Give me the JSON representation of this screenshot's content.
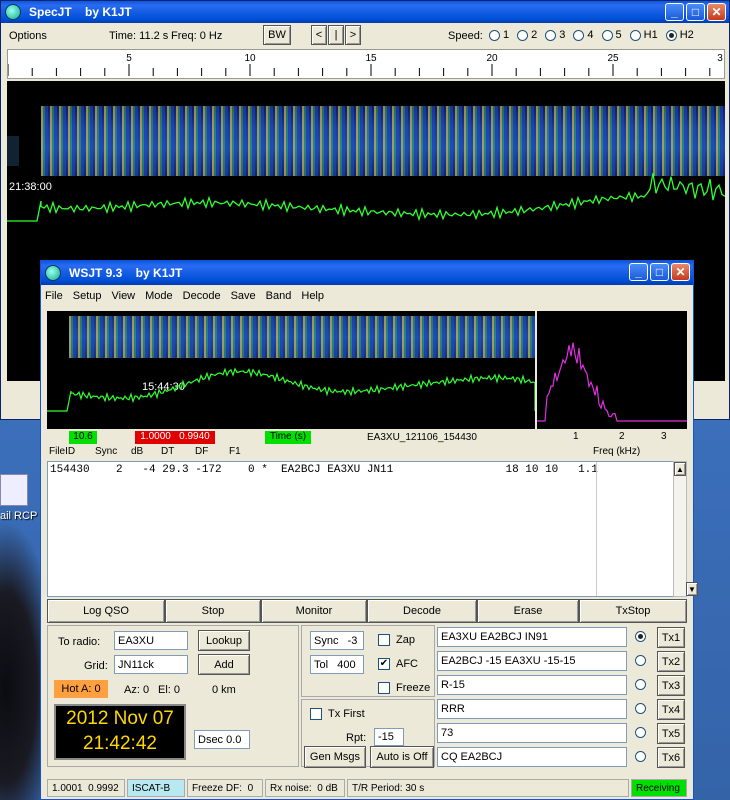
{
  "desktop": {
    "icon_label": "ail RCP"
  },
  "spec": {
    "title": "SpecJT    by K1JT",
    "options": "Options",
    "time": "Time: 11.2 s",
    "freq": "Freq: 0 Hz",
    "bw": "BW",
    "nav": [
      "<",
      "|",
      ">"
    ],
    "speed_label": "Speed:",
    "speeds": [
      "1",
      "2",
      "3",
      "4",
      "5",
      "H1",
      "H2"
    ],
    "speed_selected": "H2",
    "scale_labels": [
      "5",
      "10",
      "15",
      "20",
      "25",
      "3"
    ],
    "timestamp": "21:38:00"
  },
  "wsjt": {
    "title": "WSJT 9.3    by K1JT",
    "menu": [
      "File",
      "Setup",
      "View",
      "Mode",
      "Decode",
      "Save",
      "Band",
      "Help"
    ],
    "plot_label": "15:44:30",
    "freq_ticks": [
      "1",
      "2",
      "3"
    ],
    "status_green1": "10.6",
    "status_red": "1.0000   0.9940",
    "status_green2": "Time (s)",
    "file_id": "EA3XU_121106_154430",
    "freq_label": "Freq (kHz)",
    "col_headers": [
      "FileID",
      "Sync",
      "dB",
      "DT",
      "DF",
      "F1"
    ],
    "decode_line": "154430    2   -4 29.3 -172    0 *  EA2BCJ EA3XU JN11                 18 10 10   1.1",
    "buttons": {
      "log": "Log QSO",
      "stop": "Stop",
      "monitor": "Monitor",
      "decode": "Decode",
      "erase": "Erase",
      "txstop": "TxStop"
    },
    "to_radio_label": "To radio:",
    "to_radio": "EA3XU",
    "grid_label": "Grid:",
    "grid": "JN11ck",
    "lookup": "Lookup",
    "add": "Add",
    "hot": "Hot A: 0",
    "az": "Az: 0",
    "el": "El: 0",
    "km": "0 km",
    "date": "2012 Nov 07",
    "clock": "21:42:42",
    "dsec": "Dsec  0.0",
    "sync": "Sync   -3",
    "tol": "Tol   400",
    "zap": "Zap",
    "afc": "AFC",
    "freeze": "Freeze",
    "tx_first": "Tx First",
    "rpt_label": "Rpt:",
    "rpt": "-15",
    "gen_msgs": "Gen Msgs",
    "auto": "Auto is Off",
    "tx_msgs": [
      "EA3XU EA2BCJ IN91",
      "EA2BCJ -15 EA3XU -15-15",
      "R-15",
      "RRR",
      "73",
      "CQ EA2BCJ"
    ],
    "tx_buttons": [
      "Tx1",
      "Tx2",
      "Tx3",
      "Tx4",
      "Tx5",
      "Tx6"
    ],
    "tx_selected": 0,
    "status": {
      "a": "1.0001  0.9992",
      "mode": "ISCAT-B",
      "freeze": "Freeze DF:  0",
      "noise": "Rx noise:  0 dB",
      "tr": "T/R Period: 30 s",
      "rx": "Receiving"
    }
  },
  "colors": {
    "green": "#00e000",
    "red": "#e00000",
    "magenta": "#e030e0",
    "trace": "#30ff30",
    "clock_bg": "#000000",
    "clock_fg": "#ffd800",
    "hot": "#ffa040"
  }
}
